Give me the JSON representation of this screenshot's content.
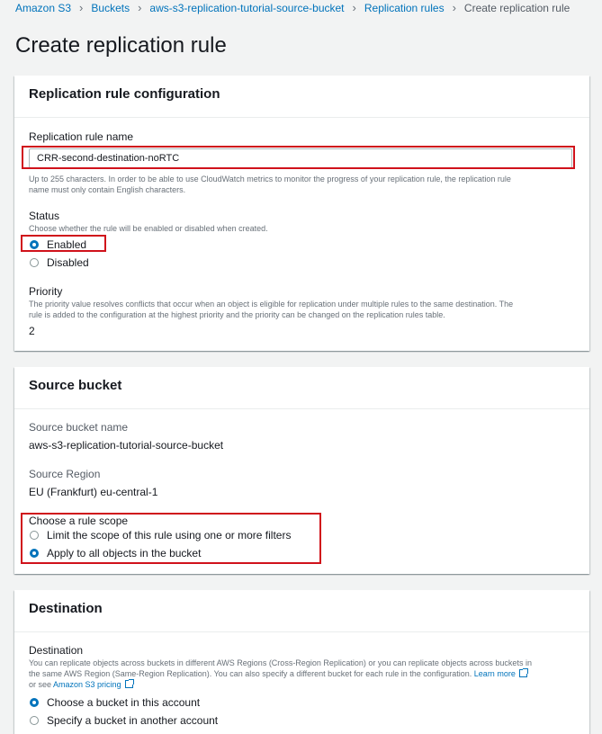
{
  "breadcrumb": [
    "Amazon S3",
    "Buckets",
    "aws-s3-replication-tutorial-source-bucket",
    "Replication rules",
    "Create replication rule"
  ],
  "page_title": "Create replication rule",
  "config": {
    "header": "Replication rule configuration",
    "name_label": "Replication rule name",
    "name_value": "CRR-second-destination-noRTC",
    "name_help_1": "Up to 255 characters. In order to be able to use CloudWatch metrics to monitor the progress of your replication rule, the replication rule",
    "name_help_2": "name must only contain English characters.",
    "status_label": "Status",
    "status_desc": "Choose whether the rule will be enabled or disabled when created.",
    "status_options": [
      "Enabled",
      "Disabled"
    ],
    "priority_label": "Priority",
    "priority_desc_1": "The priority value resolves conflicts that occur when an object is eligible for replication under multiple rules to the same destination. The",
    "priority_desc_2": "rule is added to the configuration at the highest priority and the priority can be changed on the replication rules table.",
    "priority_value": "2"
  },
  "source": {
    "header": "Source bucket",
    "bucket_label": "Source bucket name",
    "bucket_value": "aws-s3-replication-tutorial-source-bucket",
    "region_label": "Source Region",
    "region_value": "EU (Frankfurt) eu-central-1",
    "scope_label": "Choose a rule scope",
    "scope_options": [
      "Limit the scope of this rule using one or more filters",
      "Apply to all objects in the bucket"
    ]
  },
  "destination": {
    "header": "Destination",
    "label": "Destination",
    "desc_1": "You can replicate objects across buckets in different AWS Regions (Cross-Region Replication) or you can replicate objects across buckets in",
    "desc_2": "the same AWS Region (Same-Region Replication). You can also specify a different bucket for each rule in the configuration.",
    "learn_more": "Learn more",
    "or_see": "or see",
    "pricing_link": "Amazon S3 pricing",
    "options": [
      "Choose a bucket in this account",
      "Specify a bucket in another account"
    ]
  },
  "colors": {
    "link": "#0073bb",
    "highlight": "#d0121b",
    "background": "#f2f3f3"
  }
}
